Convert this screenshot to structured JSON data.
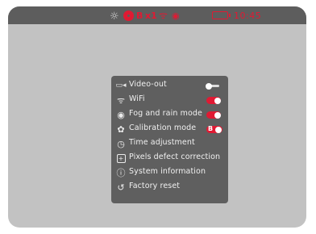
{
  "status_bar": {
    "icons": [
      "brightness-icon",
      "recording-icon",
      "wifi-icon",
      "eye-icon",
      "battery-icon"
    ],
    "mode_text": "B",
    "zoom_text": "x1",
    "time": "10:45"
  },
  "menu": {
    "items": [
      {
        "label": "Video-out",
        "icon": "video-out-icon",
        "toggle": "off"
      },
      {
        "label": "WiFi",
        "icon": "wifi-icon",
        "toggle": "on"
      },
      {
        "label": "Fog and rain mode",
        "icon": "eye-icon",
        "toggle": "on"
      },
      {
        "label": "Calibration mode",
        "icon": "calibration-icon",
        "toggle": "B"
      },
      {
        "label": "Time adjustment",
        "icon": "clock-icon"
      },
      {
        "label": "Pixels defect correction",
        "icon": "pixel-plus-icon"
      },
      {
        "label": "System information",
        "icon": "info-icon"
      },
      {
        "label": "Factory reset",
        "icon": "reset-icon"
      }
    ],
    "calibration_badge": "B"
  },
  "colors": {
    "accent": "#e01a33",
    "frame_bg": "#c2c2c2",
    "menu_bg": "#5f5f5f",
    "status_bg": "#5d5d5d"
  }
}
